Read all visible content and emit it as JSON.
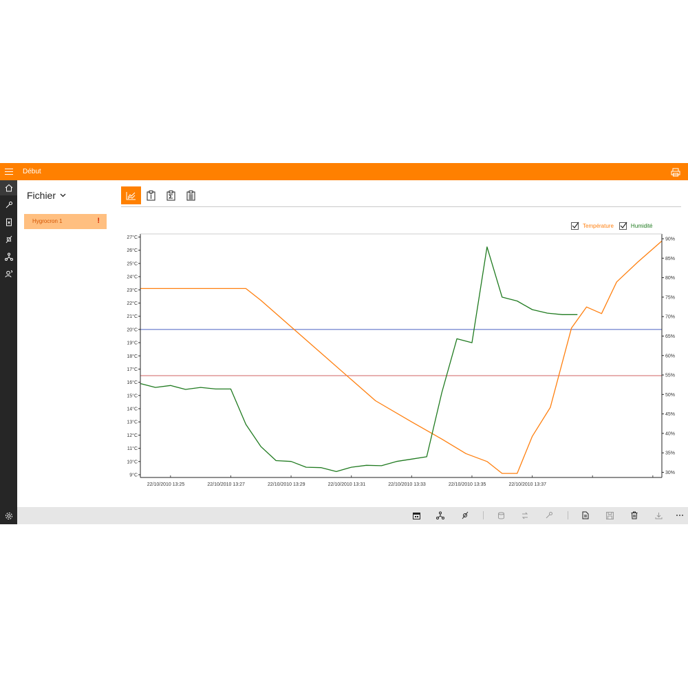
{
  "window": {
    "title": "Début"
  },
  "sidebar": {
    "icons": [
      "home-icon",
      "wrench-icon",
      "file-x-icon",
      "sensor-icon",
      "network-icon",
      "user-question-icon"
    ],
    "bottom_icons": [
      "library-icon",
      "settings-icon"
    ]
  },
  "file_panel": {
    "header_label": "Fichier",
    "devices": [
      {
        "name": "Hygrocron 1",
        "warning": "!"
      }
    ]
  },
  "tabs": [
    {
      "icon": "chart-icon",
      "active": true
    },
    {
      "icon": "info-clipboard-icon",
      "active": false
    },
    {
      "icon": "sigma-clipboard-icon",
      "active": false
    },
    {
      "icon": "list-clipboard-icon",
      "active": false
    }
  ],
  "legend": [
    {
      "label": "Température",
      "checked": true,
      "color": "#ff7f0e"
    },
    {
      "label": "Humidité",
      "checked": true,
      "color": "#1f7a1f"
    }
  ],
  "chart_data": {
    "type": "line",
    "x_labels": [
      "22/10/2010 13:25",
      "22/10/2010 13:27",
      "22/10/2010 13:29",
      "22/10/2010 13:31",
      "22/10/2010 13:33",
      "22/10/2010 13:35",
      "22/10/2010 13:37"
    ],
    "x_range_minutes": [
      0,
      15
    ],
    "y_left": {
      "ticks": [
        "27°C",
        "26°C",
        "25°C",
        "24°C",
        "23°C",
        "22°C",
        "21°C",
        "20°C",
        "19°C",
        "18°C",
        "17°C",
        "16°C",
        "15°C",
        "14°C",
        "13°C",
        "12°C",
        "11°C",
        "10°C",
        "9°C"
      ],
      "range": [
        9,
        27
      ]
    },
    "y_right": {
      "ticks": [
        "90%",
        "85%",
        "80%",
        "75%",
        "70%",
        "65%",
        "60%",
        "55%",
        "50%",
        "45%",
        "40%",
        "35%",
        "30%"
      ],
      "range": [
        30,
        90
      ]
    },
    "threshold_lines": [
      {
        "axis": "left",
        "value": 20,
        "color": "#4a5fc1"
      },
      {
        "axis": "left",
        "value": 16.5,
        "color": "#d06060"
      }
    ],
    "series": [
      {
        "name": "Température",
        "axis": "left",
        "color": "#ff7f0e",
        "points": [
          [
            0.0,
            23.1
          ],
          [
            3.5,
            23.1
          ],
          [
            4.0,
            22.2
          ],
          [
            5.0,
            20.2
          ],
          [
            6.0,
            18.2
          ],
          [
            7.0,
            16.2
          ],
          [
            7.8,
            14.6
          ],
          [
            9.0,
            13.0
          ],
          [
            10.0,
            11.7
          ],
          [
            10.8,
            10.6
          ],
          [
            11.5,
            10.0
          ],
          [
            12.0,
            9.1
          ],
          [
            12.5,
            9.1
          ],
          [
            13.0,
            11.9
          ],
          [
            13.6,
            14.1
          ],
          [
            14.3,
            20.1
          ],
          [
            14.8,
            21.7
          ],
          [
            15.3,
            21.2
          ],
          [
            15.8,
            23.6
          ],
          [
            16.5,
            25.1
          ],
          [
            17.3,
            26.7
          ]
        ]
      },
      {
        "name": "Humidité",
        "axis": "right",
        "color": "#1f7a1f",
        "points": [
          [
            0.0,
            52.8
          ],
          [
            0.5,
            51.8
          ],
          [
            1.0,
            52.3
          ],
          [
            1.5,
            51.3
          ],
          [
            2.0,
            51.8
          ],
          [
            2.5,
            51.4
          ],
          [
            3.0,
            51.4
          ],
          [
            3.5,
            42.3
          ],
          [
            4.0,
            36.6
          ],
          [
            4.5,
            33.0
          ],
          [
            5.0,
            32.8
          ],
          [
            5.5,
            31.3
          ],
          [
            6.0,
            31.2
          ],
          [
            6.5,
            30.2
          ],
          [
            7.0,
            31.3
          ],
          [
            7.5,
            31.8
          ],
          [
            8.0,
            31.7
          ],
          [
            8.5,
            32.8
          ],
          [
            9.0,
            33.4
          ],
          [
            9.5,
            34.0
          ],
          [
            10.0,
            50.5
          ],
          [
            10.5,
            64.3
          ],
          [
            11.0,
            63.3
          ],
          [
            11.5,
            87.9
          ],
          [
            12.0,
            75.0
          ],
          [
            12.5,
            74.0
          ],
          [
            13.0,
            71.8
          ],
          [
            13.5,
            70.9
          ],
          [
            14.0,
            70.5
          ],
          [
            14.5,
            70.5
          ]
        ]
      }
    ]
  },
  "bottom_toolbar": {
    "icons": [
      "calendar-icon",
      "network-icon",
      "sensor-icon",
      "|",
      "database-icon",
      "sync-icon",
      "wrench-icon",
      "|",
      "document-icon",
      "save-icon",
      "trash-icon",
      "download-icon",
      "more-icon"
    ]
  }
}
